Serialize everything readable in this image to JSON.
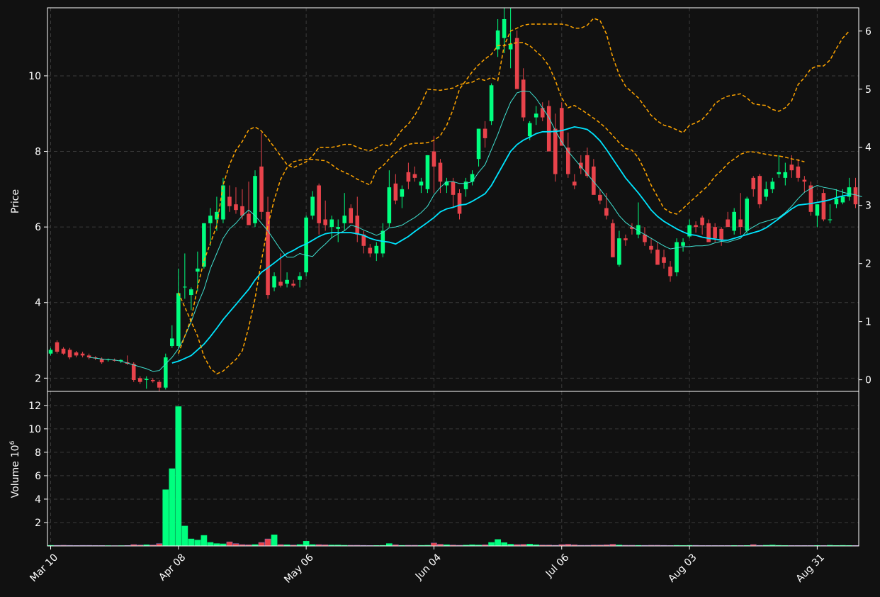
{
  "colors": {
    "background": "#111111",
    "up": "#00ff7f",
    "down": "#e8434b",
    "ma_short": "#40e0d0",
    "ma_long": "#00e5ff",
    "band": "#ffa500",
    "grid": "#3a3a3a",
    "text": "#ffffff"
  },
  "chart_data": {
    "type": "candlestick",
    "ylabel_price": "Price",
    "ylabel_volume": "Volume",
    "volume_exponent": "6",
    "price_ylim": [
      1.65,
      11.8
    ],
    "price_yticks": [
      2,
      4,
      6,
      8,
      10
    ],
    "secondary_ylim": [
      -0.2,
      6.4
    ],
    "secondary_yticks": [
      0,
      1,
      2,
      3,
      4,
      5,
      6
    ],
    "volume_ylim": [
      0,
      13.2
    ],
    "volume_yticks": [
      2,
      4,
      6,
      8,
      10,
      12
    ],
    "x_ticks": [
      {
        "label": "Mar 10",
        "index": 0
      },
      {
        "label": "Apr 08",
        "index": 20
      },
      {
        "label": "May 06",
        "index": 40
      },
      {
        "label": "Jun 04",
        "index": 60
      },
      {
        "label": "Jul 06",
        "index": 80
      },
      {
        "label": "Aug 03",
        "index": 100
      },
      {
        "label": "Aug 31",
        "index": 120
      }
    ],
    "ohlc": [
      [
        2.65,
        2.8,
        2.6,
        2.75
      ],
      [
        2.95,
        3.0,
        2.65,
        2.7
      ],
      [
        2.78,
        2.82,
        2.62,
        2.65
      ],
      [
        2.75,
        2.8,
        2.5,
        2.55
      ],
      [
        2.68,
        2.72,
        2.55,
        2.6
      ],
      [
        2.65,
        2.7,
        2.55,
        2.6
      ],
      [
        2.6,
        2.65,
        2.5,
        2.55
      ],
      [
        2.55,
        2.58,
        2.48,
        2.52
      ],
      [
        2.5,
        2.55,
        2.38,
        2.42
      ],
      [
        2.48,
        2.52,
        2.44,
        2.5
      ],
      [
        2.48,
        2.52,
        2.44,
        2.46
      ],
      [
        2.45,
        2.5,
        2.4,
        2.48
      ],
      [
        2.42,
        2.6,
        2.35,
        2.38
      ],
      [
        2.38,
        2.42,
        1.9,
        1.95
      ],
      [
        2.0,
        2.05,
        1.85,
        1.9
      ],
      [
        1.95,
        2.05,
        1.72,
        1.98
      ],
      [
        1.95,
        2.0,
        1.88,
        1.92
      ],
      [
        1.9,
        1.95,
        1.65,
        1.75
      ],
      [
        1.75,
        2.65,
        1.7,
        2.55
      ],
      [
        2.85,
        3.4,
        2.8,
        3.05
      ],
      [
        2.85,
        4.9,
        2.8,
        4.25
      ],
      [
        4.4,
        5.3,
        4.1,
        4.42
      ],
      [
        4.2,
        4.4,
        3.8,
        4.35
      ],
      [
        4.82,
        5.35,
        4.3,
        4.9
      ],
      [
        4.95,
        6.1,
        4.9,
        6.1
      ],
      [
        6.1,
        6.5,
        5.5,
        6.3
      ],
      [
        6.2,
        6.8,
        5.9,
        6.4
      ],
      [
        6.2,
        7.3,
        6.1,
        7.1
      ],
      [
        6.8,
        7.1,
        6.4,
        6.55
      ],
      [
        6.6,
        7.05,
        6.35,
        6.45
      ],
      [
        6.55,
        7.0,
        6.2,
        6.3
      ],
      [
        6.35,
        7.2,
        6.1,
        6.05
      ],
      [
        6.1,
        7.5,
        6.0,
        7.35
      ],
      [
        7.6,
        8.5,
        6.2,
        6.4
      ],
      [
        6.4,
        6.8,
        4.1,
        4.2
      ],
      [
        4.4,
        4.8,
        4.3,
        4.7
      ],
      [
        4.55,
        5.3,
        4.4,
        4.45
      ],
      [
        4.5,
        4.8,
        4.4,
        4.6
      ],
      [
        4.5,
        4.6,
        4.4,
        4.45
      ],
      [
        4.6,
        4.8,
        4.4,
        4.7
      ],
      [
        4.8,
        6.3,
        4.7,
        6.25
      ],
      [
        6.3,
        6.95,
        6.2,
        6.8
      ],
      [
        7.1,
        7.15,
        5.8,
        6.1
      ],
      [
        6.2,
        6.7,
        5.9,
        6.05
      ],
      [
        6.0,
        6.3,
        5.7,
        6.2
      ],
      [
        5.95,
        6.2,
        5.6,
        6.0
      ],
      [
        6.1,
        6.9,
        5.9,
        6.3
      ],
      [
        6.5,
        6.6,
        6.1,
        6.1
      ],
      [
        6.3,
        6.8,
        5.6,
        5.8
      ],
      [
        5.8,
        5.9,
        5.3,
        5.5
      ],
      [
        5.45,
        5.55,
        5.2,
        5.3
      ],
      [
        5.3,
        5.6,
        5.1,
        5.5
      ],
      [
        5.3,
        6.1,
        5.2,
        5.9
      ],
      [
        6.1,
        7.5,
        6.0,
        7.05
      ],
      [
        7.15,
        7.4,
        6.6,
        6.7
      ],
      [
        6.8,
        7.1,
        6.5,
        7.0
      ],
      [
        7.45,
        7.7,
        7.0,
        7.2
      ],
      [
        7.4,
        7.6,
        7.2,
        7.3
      ],
      [
        7.1,
        7.3,
        6.9,
        7.2
      ],
      [
        7.0,
        7.9,
        6.9,
        7.9
      ],
      [
        8.0,
        8.4,
        6.9,
        7.6
      ],
      [
        7.7,
        7.8,
        6.9,
        7.2
      ],
      [
        7.1,
        7.3,
        6.9,
        7.2
      ],
      [
        7.2,
        7.3,
        6.5,
        6.85
      ],
      [
        6.9,
        7.0,
        6.2,
        6.35
      ],
      [
        7.0,
        7.3,
        6.8,
        7.2
      ],
      [
        7.2,
        7.5,
        7.1,
        7.4
      ],
      [
        7.8,
        8.6,
        7.6,
        8.6
      ],
      [
        8.6,
        8.8,
        8.1,
        8.35
      ],
      [
        8.8,
        9.8,
        8.7,
        9.75
      ],
      [
        10.7,
        11.5,
        10.5,
        11.2
      ],
      [
        11.0,
        11.8,
        10.6,
        11.5
      ],
      [
        10.7,
        11.8,
        10.2,
        10.85
      ],
      [
        11.0,
        11.2,
        9.8,
        9.65
      ],
      [
        9.9,
        10.2,
        8.8,
        8.9
      ],
      [
        8.4,
        8.8,
        8.3,
        8.75
      ],
      [
        8.9,
        9.2,
        8.7,
        9.0
      ],
      [
        9.15,
        9.3,
        8.8,
        8.9
      ],
      [
        9.2,
        9.35,
        8.2,
        8.0
      ],
      [
        8.6,
        9.0,
        7.2,
        7.4
      ],
      [
        9.15,
        9.3,
        8.2,
        8.15
      ],
      [
        8.1,
        8.5,
        7.3,
        7.4
      ],
      [
        7.2,
        7.4,
        7.0,
        7.1
      ],
      [
        7.7,
        7.9,
        7.4,
        7.55
      ],
      [
        7.9,
        8.1,
        7.3,
        7.35
      ],
      [
        7.6,
        7.8,
        6.9,
        6.85
      ],
      [
        6.85,
        7.0,
        6.6,
        6.7
      ],
      [
        6.5,
        6.9,
        6.2,
        6.3
      ],
      [
        6.1,
        6.2,
        5.2,
        5.2
      ],
      [
        5.0,
        5.9,
        4.95,
        5.7
      ],
      [
        5.7,
        5.8,
        5.5,
        5.65
      ],
      [
        6.0,
        6.1,
        5.8,
        5.95
      ],
      [
        5.8,
        6.65,
        5.7,
        6.05
      ],
      [
        5.8,
        6.0,
        5.5,
        5.6
      ],
      [
        5.5,
        5.7,
        5.3,
        5.4
      ],
      [
        5.4,
        5.6,
        5.0,
        5.0
      ],
      [
        5.2,
        5.4,
        4.9,
        5.05
      ],
      [
        4.95,
        5.1,
        4.55,
        4.7
      ],
      [
        4.8,
        5.7,
        4.7,
        5.6
      ],
      [
        5.5,
        5.7,
        5.35,
        5.6
      ],
      [
        5.75,
        6.2,
        5.7,
        6.05
      ],
      [
        6.05,
        6.15,
        5.85,
        6.0
      ],
      [
        6.25,
        6.3,
        5.8,
        6.05
      ],
      [
        6.1,
        6.2,
        5.6,
        5.6
      ],
      [
        6.0,
        6.1,
        5.6,
        5.7
      ],
      [
        5.95,
        6.0,
        5.5,
        5.65
      ],
      [
        6.2,
        6.4,
        6.0,
        6.0
      ],
      [
        5.9,
        6.5,
        5.8,
        6.4
      ],
      [
        6.2,
        6.9,
        5.8,
        6.0
      ],
      [
        5.9,
        6.8,
        5.8,
        6.75
      ],
      [
        7.3,
        7.35,
        6.8,
        7.0
      ],
      [
        7.35,
        7.4,
        6.5,
        6.6
      ],
      [
        6.8,
        7.2,
        6.7,
        7.0
      ],
      [
        7.0,
        7.3,
        6.9,
        7.2
      ],
      [
        7.4,
        7.9,
        7.3,
        7.45
      ],
      [
        7.3,
        7.7,
        7.1,
        7.45
      ],
      [
        7.65,
        7.9,
        7.3,
        7.5
      ],
      [
        7.6,
        7.8,
        7.2,
        7.3
      ],
      [
        7.25,
        7.35,
        6.9,
        7.2
      ],
      [
        7.1,
        7.2,
        6.3,
        6.4
      ],
      [
        6.3,
        6.6,
        6.0,
        6.6
      ],
      [
        6.9,
        7.0,
        6.15,
        6.2
      ],
      [
        6.2,
        6.6,
        6.1,
        6.2
      ],
      [
        6.6,
        7.0,
        6.5,
        6.75
      ],
      [
        6.65,
        7.0,
        6.6,
        6.8
      ],
      [
        6.8,
        7.3,
        6.7,
        7.05
      ],
      [
        7.05,
        7.3,
        6.5,
        6.6
      ]
    ],
    "volume": [
      0.05,
      0.05,
      0.06,
      0.05,
      0.04,
      0.05,
      0.05,
      0.04,
      0.04,
      0.03,
      0.03,
      0.03,
      0.04,
      0.12,
      0.08,
      0.1,
      0.08,
      0.2,
      4.8,
      6.6,
      11.9,
      1.7,
      0.6,
      0.5,
      0.9,
      0.3,
      0.2,
      0.18,
      0.35,
      0.2,
      0.12,
      0.1,
      0.12,
      0.3,
      0.6,
      0.95,
      0.12,
      0.1,
      0.08,
      0.12,
      0.4,
      0.12,
      0.12,
      0.1,
      0.08,
      0.08,
      0.06,
      0.06,
      0.06,
      0.05,
      0.04,
      0.04,
      0.05,
      0.2,
      0.1,
      0.05,
      0.06,
      0.06,
      0.05,
      0.06,
      0.25,
      0.15,
      0.1,
      0.08,
      0.06,
      0.07,
      0.1,
      0.08,
      0.1,
      0.3,
      0.55,
      0.28,
      0.15,
      0.12,
      0.14,
      0.16,
      0.1,
      0.08,
      0.08,
      0.06,
      0.12,
      0.15,
      0.1,
      0.06,
      0.06,
      0.08,
      0.08,
      0.1,
      0.15,
      0.08,
      0.06,
      0.06,
      0.05,
      0.05,
      0.06,
      0.06,
      0.05,
      0.04,
      0.05,
      0.04,
      0.05,
      0.05,
      0.04,
      0.04,
      0.04,
      0.04,
      0.04,
      0.04,
      0.04,
      0.04,
      0.12,
      0.05,
      0.06,
      0.08,
      0.05,
      0.04,
      0.04,
      0.04,
      0.04,
      0.04,
      0.04,
      0.04,
      0.06,
      0.04,
      0.05,
      0.04,
      0.04,
      0.04,
      0.04,
      0.04,
      0.04,
      0.04,
      0.04,
      0.04,
      0.04,
      0.04,
      0.04,
      0.04,
      0.04,
      0.04,
      0.04
    ],
    "ma_short": [
      null,
      null,
      null,
      null,
      null,
      null,
      2.55,
      2.53,
      2.51,
      2.49,
      2.48,
      2.45,
      2.4,
      2.35,
      2.3,
      2.25,
      2.18,
      2.2,
      2.38,
      2.55,
      2.78,
      3.1,
      3.5,
      3.95,
      4.35,
      4.9,
      5.3,
      5.7,
      5.95,
      6.1,
      6.3,
      6.45,
      6.3,
      6.1,
      5.9,
      5.65,
      5.4,
      5.2,
      5.2,
      5.3,
      5.25,
      5.22,
      5.4,
      5.55,
      5.72,
      5.82,
      5.9,
      6.05,
      6.0,
      5.92,
      5.85,
      5.78,
      5.85,
      5.98,
      6.0,
      6.05,
      6.15,
      6.25,
      6.38,
      6.55,
      6.85,
      7.05,
      7.2,
      7.2,
      7.15,
      7.15,
      7.2,
      7.45,
      7.65,
      8.05,
      8.45,
      8.9,
      9.3,
      9.55,
      9.6,
      9.58,
      9.4,
      9.15,
      8.9,
      8.55,
      8.25,
      8.0,
      7.8,
      7.6,
      7.4,
      7.2,
      7.0,
      6.78,
      6.55,
      6.3,
      6.12,
      6.0,
      5.9,
      5.8,
      5.7,
      5.6,
      5.5,
      5.42,
      5.45,
      5.48,
      5.48,
      5.5,
      5.5,
      5.52,
      5.58,
      5.62,
      5.6,
      5.65,
      5.7,
      5.9,
      6.0,
      6.1,
      6.15,
      6.2,
      6.25,
      6.38,
      6.55,
      6.75,
      6.92,
      7.02,
      7.1,
      7.05,
      7.02,
      6.98,
      6.92,
      6.88,
      6.85,
      6.8
    ],
    "ma_long": [
      null,
      null,
      null,
      null,
      null,
      null,
      null,
      null,
      null,
      null,
      null,
      null,
      null,
      null,
      null,
      null,
      null,
      null,
      null,
      2.4,
      2.45,
      2.52,
      2.6,
      2.75,
      2.9,
      3.1,
      3.32,
      3.55,
      3.75,
      3.95,
      4.15,
      4.35,
      4.6,
      4.8,
      4.92,
      5.05,
      5.18,
      5.3,
      5.38,
      5.48,
      5.55,
      5.65,
      5.75,
      5.82,
      5.85,
      5.85,
      5.85,
      5.85,
      5.82,
      5.78,
      5.7,
      5.65,
      5.62,
      5.6,
      5.55,
      5.65,
      5.75,
      5.88,
      6.0,
      6.12,
      6.25,
      6.4,
      6.48,
      6.52,
      6.58,
      6.6,
      6.68,
      6.78,
      6.88,
      7.1,
      7.4,
      7.7,
      8.0,
      8.18,
      8.3,
      8.38,
      8.47,
      8.52,
      8.52,
      8.53,
      8.55,
      8.6,
      8.65,
      8.62,
      8.58,
      8.45,
      8.28,
      8.05,
      7.8,
      7.55,
      7.3,
      7.1,
      6.9,
      6.68,
      6.45,
      6.28,
      6.15,
      6.05,
      5.95,
      5.87,
      5.8,
      5.78,
      5.73,
      5.7,
      5.68,
      5.65,
      5.65,
      5.7,
      5.75,
      5.8,
      5.85,
      5.9,
      5.98,
      6.1,
      6.22,
      6.35,
      6.48,
      6.58,
      6.6,
      6.62,
      6.65,
      6.68,
      6.72,
      6.78,
      6.82,
      6.85
    ],
    "band_upper": [
      null,
      null,
      null,
      null,
      null,
      null,
      null,
      null,
      null,
      null,
      null,
      null,
      null,
      null,
      null,
      null,
      null,
      null,
      null,
      null,
      0.45,
      0.75,
      1.05,
      1.6,
      2.05,
      2.35,
      2.65,
      3.35,
      3.7,
      3.95,
      4.1,
      4.3,
      4.35,
      4.28,
      4.15,
      4.0,
      3.85,
      3.7,
      3.65,
      3.7,
      3.75,
      3.85,
      4.0,
      4.0,
      4.0,
      4.02,
      4.05,
      4.05,
      4.0,
      3.96,
      3.94,
      3.99,
      4.05,
      4.02,
      4.15,
      4.3,
      4.4,
      4.55,
      4.75,
      5.0,
      4.99,
      4.98,
      5.0,
      5.02,
      5.08,
      5.1,
      5.12,
      5.18,
      5.15,
      5.2,
      5.15,
      5.75,
      6.0,
      6.05,
      6.1,
      6.12,
      6.12,
      6.12,
      6.12,
      6.12,
      6.12,
      6.1,
      6.05,
      6.05,
      6.1,
      6.22,
      6.18,
      5.95,
      5.55,
      5.25,
      5.05,
      4.95,
      4.85,
      4.7,
      4.55,
      4.45,
      4.38,
      4.35,
      4.3,
      4.25,
      4.38,
      4.42,
      4.48,
      4.6,
      4.75,
      4.83,
      4.88,
      4.9,
      4.92,
      4.85,
      4.75,
      4.73,
      4.72,
      4.65,
      4.62,
      4.68,
      4.8,
      5.08,
      5.2,
      5.35,
      5.4,
      5.4,
      5.5,
      5.7,
      5.88,
      6.0
    ],
    "band_lower": [
      null,
      null,
      null,
      null,
      null,
      null,
      null,
      null,
      null,
      null,
      null,
      null,
      null,
      null,
      null,
      null,
      null,
      null,
      null,
      null,
      1.5,
      1.25,
      1.0,
      0.75,
      0.4,
      0.2,
      0.1,
      0.15,
      0.25,
      0.35,
      0.5,
      0.9,
      1.4,
      2.05,
      2.65,
      3.1,
      3.45,
      3.65,
      3.75,
      3.78,
      3.79,
      3.79,
      3.78,
      3.77,
      3.7,
      3.62,
      3.57,
      3.52,
      3.45,
      3.4,
      3.35,
      3.6,
      3.68,
      3.8,
      3.9,
      4.0,
      4.05,
      4.07,
      4.07,
      4.08,
      4.12,
      4.2,
      4.38,
      4.65,
      5.0,
      5.15,
      5.3,
      5.42,
      5.52,
      5.6,
      5.75,
      5.75,
      5.78,
      5.8,
      5.8,
      5.75,
      5.65,
      5.55,
      5.4,
      5.15,
      4.85,
      4.68,
      4.72,
      4.65,
      4.58,
      4.5,
      4.42,
      4.32,
      4.2,
      4.08,
      3.98,
      3.95,
      3.82,
      3.6,
      3.35,
      3.15,
      2.95,
      2.88,
      2.85,
      2.95,
      3.05,
      3.15,
      3.25,
      3.35,
      3.5,
      3.6,
      3.72,
      3.8,
      3.88,
      3.92,
      3.92,
      3.9,
      3.88,
      3.86,
      3.85,
      3.83,
      3.8,
      3.78,
      3.75
    ]
  }
}
